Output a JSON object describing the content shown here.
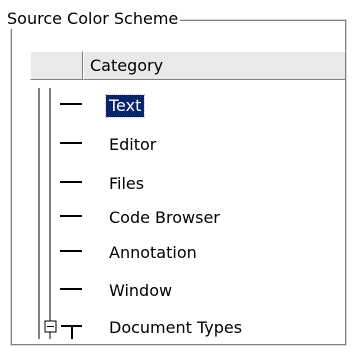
{
  "group": {
    "title": "Source Color Scheme"
  },
  "header": {
    "icon_col": "",
    "category_col": "Category"
  },
  "tree": {
    "items": [
      {
        "label": "Text",
        "selected": true
      },
      {
        "label": "Editor",
        "selected": false
      },
      {
        "label": "Files",
        "selected": false
      },
      {
        "label": "Code Browser",
        "selected": false
      },
      {
        "label": "Annotation",
        "selected": false
      },
      {
        "label": "Window",
        "selected": false
      },
      {
        "label": "Document Types",
        "selected": false,
        "expandable": true,
        "expanded": true
      }
    ]
  },
  "colors": {
    "selection_bg": "#0a246a",
    "selection_fg": "#ffffff",
    "header_bg": "#e9e9e9"
  }
}
